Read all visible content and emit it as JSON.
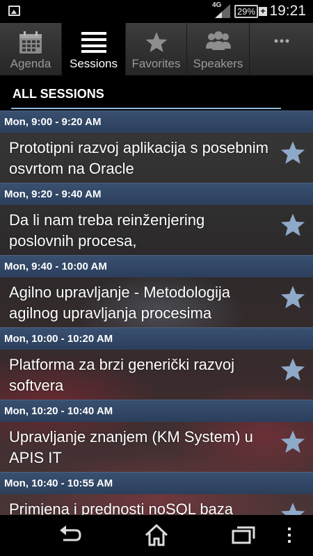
{
  "status_bar": {
    "network": "4G",
    "battery": "29%",
    "time": "19:21",
    "icons": [
      "image-notification-icon",
      "signal-icon",
      "battery-icon",
      "charging-plus-icon"
    ]
  },
  "tabs": [
    {
      "label": "Agenda",
      "icon": "calendar-icon",
      "active": false
    },
    {
      "label": "Sessions",
      "icon": "list-icon",
      "active": true
    },
    {
      "label": "Favorites",
      "icon": "star-icon",
      "active": false
    },
    {
      "label": "Speakers",
      "icon": "people-icon",
      "active": false
    },
    {
      "label": "",
      "icon": "overflow-menu-icon",
      "active": false
    }
  ],
  "section_title": "ALL SESSIONS",
  "sessions": [
    {
      "time": "Mon, 9:00 - 9:20 AM",
      "title": "Prototipni razvoj aplikacija s posebnim osvrtom na Oracle"
    },
    {
      "time": "Mon, 9:20 - 9:40 AM",
      "title": "Da li nam treba reinženjering poslovnih procesa,"
    },
    {
      "time": "Mon, 9:40 - 10:00 AM",
      "title": "Agilno upravljanje - Metodologija agilnog upravljanja procesima"
    },
    {
      "time": "Mon, 10:00 - 10:20 AM",
      "title": "Platforma za brzi generički razvoj softvera"
    },
    {
      "time": "Mon, 10:20 - 10:40 AM",
      "title": "Upravljanje znanjem (KM System) u APIS IT"
    },
    {
      "time": "Mon, 10:40 - 10:55 AM",
      "title": "Primjena i prednosti noSQL baza"
    }
  ],
  "nav_bar": {
    "icons": [
      "back-icon",
      "home-icon",
      "recent-apps-icon",
      "menu-icon"
    ]
  },
  "colors": {
    "accent": "#8fb9d9",
    "header_blue": "#2f4565",
    "star": "#8fa9c9"
  }
}
